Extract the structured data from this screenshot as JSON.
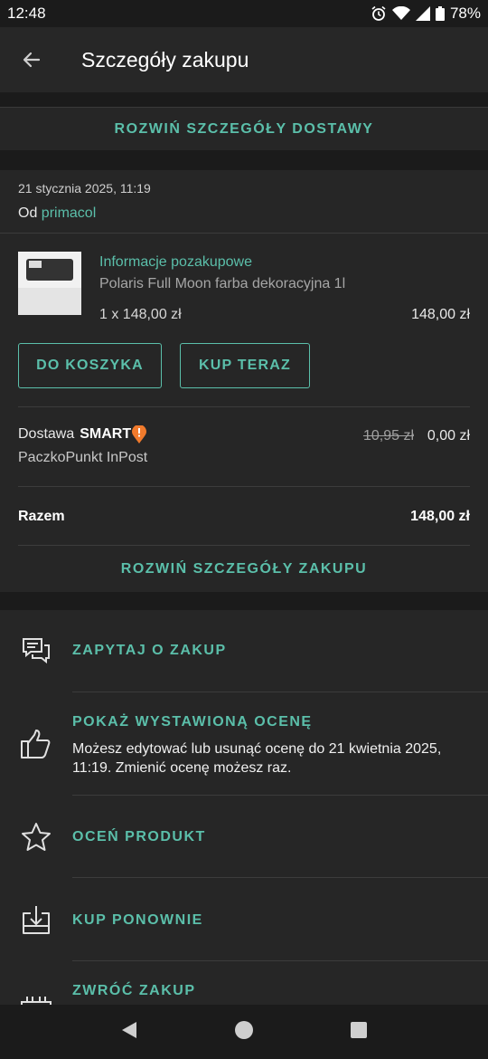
{
  "status": {
    "time": "12:48",
    "battery": "78%"
  },
  "appbar": {
    "title": "Szczegóły zakupu"
  },
  "delivery_expand": "ROZWIŃ SZCZEGÓŁY DOSTAWY",
  "purchase": {
    "date": "21 stycznia 2025, 11:19",
    "seller_prefix": "Od",
    "seller_name": "primacol",
    "info_link": "Informacje pozakupowe",
    "product_name": "Polaris Full Moon farba dekoracyjna 1l",
    "quantity_line": "1 x 148,00 zł",
    "line_total": "148,00 zł",
    "add_to_cart": "DO KOSZYKA",
    "buy_now": "KUP TERAZ",
    "delivery_label": "Dostawa",
    "smart_label": "SMART",
    "carrier": "PaczkoPunkt InPost",
    "delivery_old_price": "10,95 zł",
    "delivery_price": "0,00 zł",
    "total_label": "Razem",
    "total_value": "148,00 zł",
    "expand_purchase": "ROZWIŃ SZCZEGÓŁY ZAKUPU"
  },
  "actions": [
    {
      "label": "ZAPYTAJ O ZAKUP",
      "icon": "chat-icon"
    },
    {
      "label": "POKAŻ WYSTAWIONĄ OCENĘ",
      "icon": "thumbs-up-icon",
      "description": "Możesz edytować lub usunąć ocenę do 21 kwietnia 2025, 11:19. Zmienić ocenę możesz raz."
    },
    {
      "label": "OCEŃ PRODUKT",
      "icon": "star-icon"
    },
    {
      "label": "KUP PONOWNIE",
      "icon": "buy-again-icon"
    },
    {
      "label": "ZWRÓĆ ZAKUP",
      "icon": "return-icon"
    }
  ],
  "colors": {
    "accent": "#5bbfaa",
    "background": "#1b1b1b",
    "card": "#262626",
    "smart_badge": "#f07a2c"
  }
}
